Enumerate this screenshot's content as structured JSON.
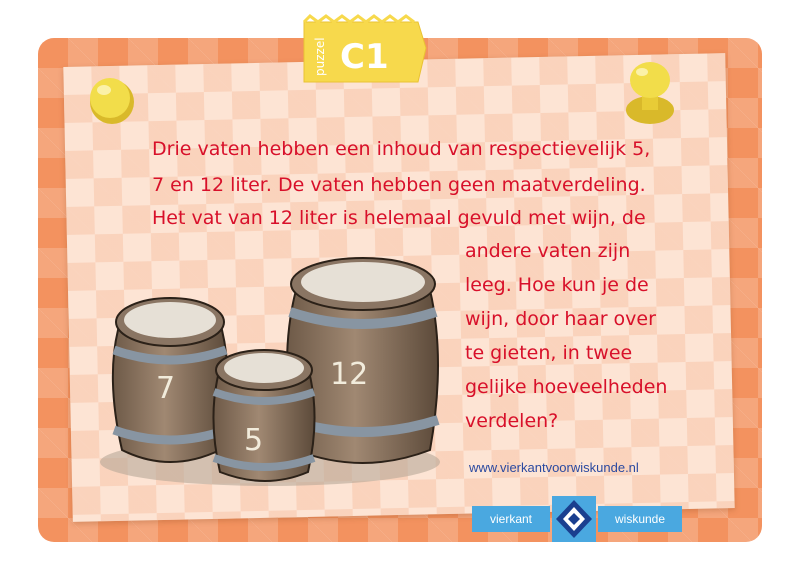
{
  "tab": {
    "small": "puzzel",
    "code": "C1"
  },
  "puzzle_lines_full": [
    "Drie vaten hebben een inhoud van respectievelijk 5,",
    "7 en 12 liter. De vaten hebben geen maatverdeling.",
    "Het vat van 12 liter is helemaal gevuld met wijn, de"
  ],
  "puzzle_lines_right": [
    "andere vaten zijn",
    "leeg. Hoe kun je de",
    "wijn, door haar over",
    "te gieten, in twee",
    "gelijke hoeveelheden",
    "verdelen?"
  ],
  "barrels": {
    "small": "5",
    "medium": "7",
    "large": "12"
  },
  "website": "www.vierkantvoorwiskunde.nl",
  "logo": {
    "left": "vierkant",
    "right": "wiskunde"
  },
  "colors": {
    "text": "#d8102a",
    "card": "#f3925f",
    "paper": "#fde4d4",
    "logo": "#4aa8e0",
    "tab": "#f7d94c"
  }
}
